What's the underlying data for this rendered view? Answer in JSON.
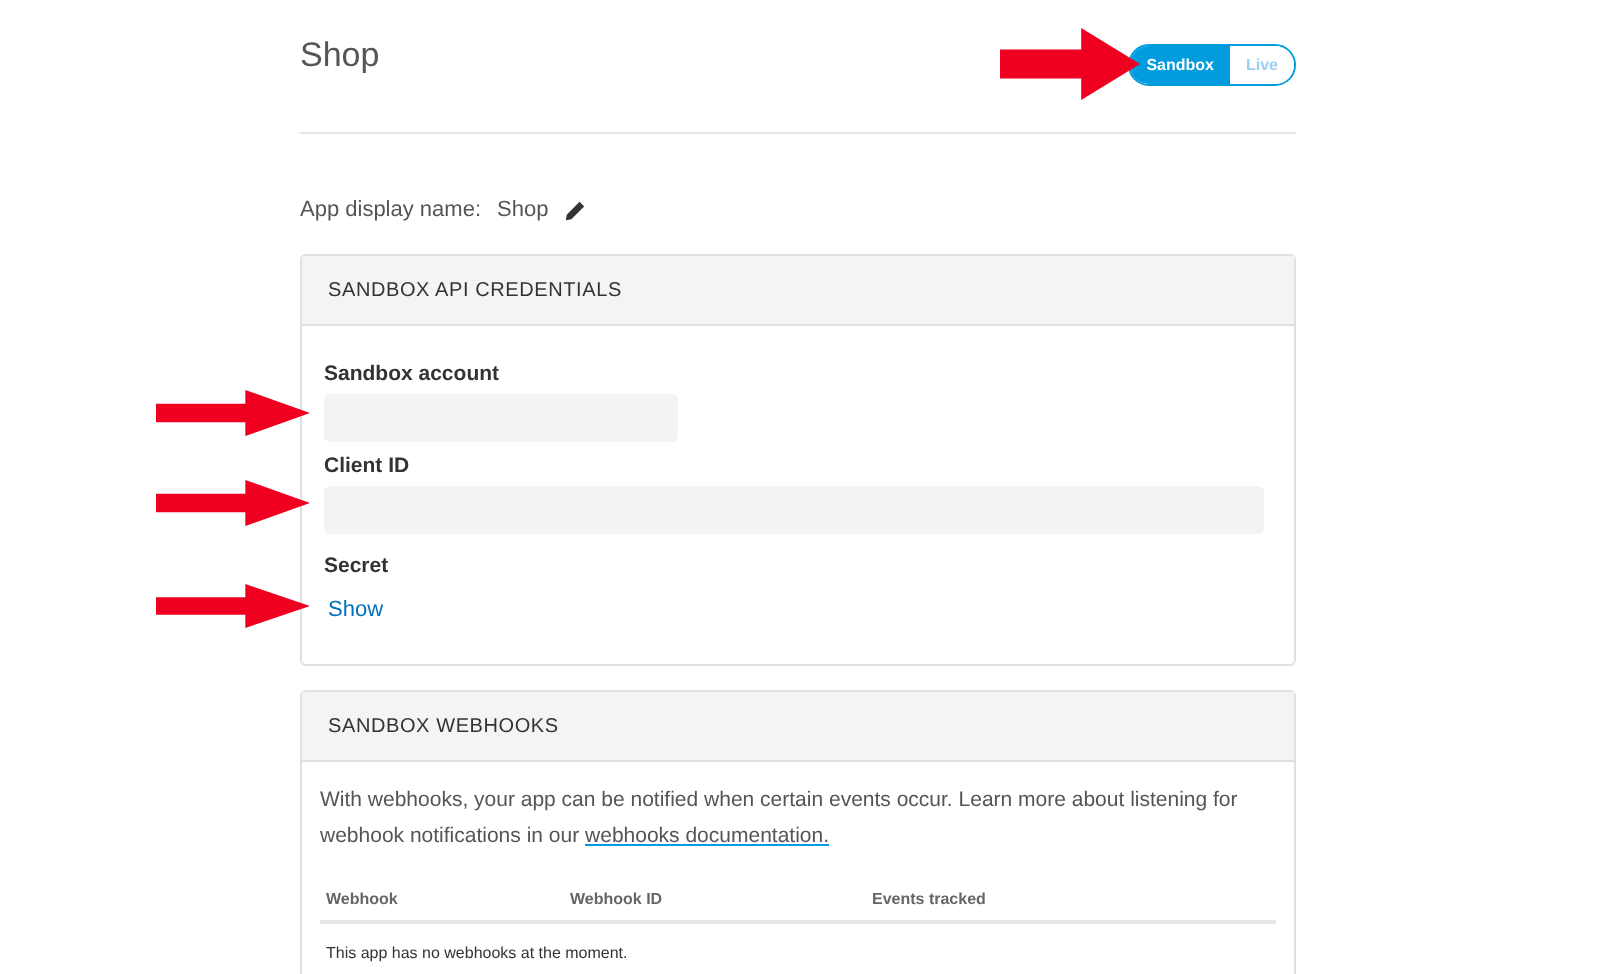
{
  "page": {
    "title": "Shop"
  },
  "environment_toggle": [
    {
      "label": "Sandbox",
      "selected": true
    },
    {
      "label": "Live",
      "selected": false
    }
  ],
  "app_display_name": {
    "label": "App display name:",
    "value": "Shop"
  },
  "credentials_card": {
    "title": "SANDBOX API CREDENTIALS",
    "fields": [
      {
        "kind": "short_field",
        "label": "Sandbox account"
      },
      {
        "kind": "field",
        "label": "Client ID"
      },
      {
        "kind": "link",
        "label": "Secret",
        "link": "Show"
      }
    ]
  },
  "webhooks_card": {
    "title": "SANDBOX WEBHOOKS",
    "description": "With webhooks, your app can be notified when certain events occur. Learn more about listening for webhook notifications in our",
    "link": "webhooks documentation.",
    "columns": [
      "Webhook",
      "Webhook ID",
      "Events tracked"
    ],
    "empty_message": "This app has no webhooks at the moment."
  }
}
